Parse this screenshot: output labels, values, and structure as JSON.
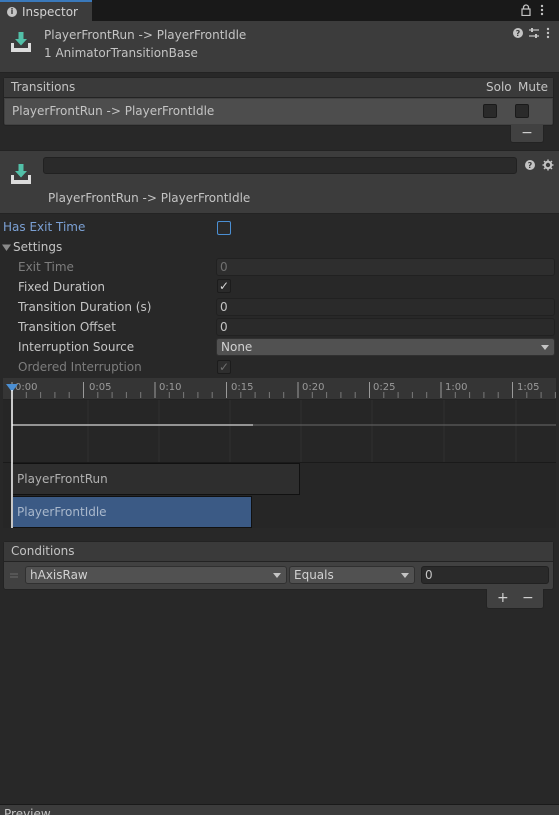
{
  "tab": {
    "label": "Inspector",
    "icon": "info-icon"
  },
  "header": {
    "title": "PlayerFrontRun -> PlayerFrontIdle",
    "subtitle": "1 AnimatorTransitionBase"
  },
  "transitions": {
    "heading": "Transitions",
    "solo_label": "Solo",
    "mute_label": "Mute",
    "row_label": "PlayerFrontRun -> PlayerFrontIdle",
    "remove_label": "−"
  },
  "transition": {
    "name_value": "",
    "title": "PlayerFrontRun -> PlayerFrontIdle"
  },
  "settings": {
    "has_exit_time_label": "Has Exit Time",
    "settings_label": "Settings",
    "exit_time_label": "Exit Time",
    "exit_time_value": "0",
    "fixed_duration_label": "Fixed Duration",
    "transition_duration_label": "Transition Duration (s)",
    "transition_duration_value": "0",
    "transition_offset_label": "Transition Offset",
    "transition_offset_value": "0",
    "interruption_source_label": "Interruption Source",
    "interruption_source_value": "None",
    "ordered_interruption_label": "Ordered Interruption"
  },
  "timeline": {
    "ticks": [
      "0:00",
      "0:05",
      "0:10",
      "0:15",
      "0:20",
      "0:25",
      "1:00",
      "1:05"
    ],
    "source_clip": "PlayerFrontRun",
    "dest_clip": "PlayerFrontIdle"
  },
  "conditions": {
    "heading": "Conditions",
    "parameter": "hAxisRaw",
    "mode": "Equals",
    "value": "0",
    "add_label": "+",
    "remove_label": "−"
  },
  "preview": {
    "label": "Preview"
  },
  "colors": {
    "accent": "#3a79bb",
    "link_label": "#7ba0d4",
    "dest_clip": "#3b5a85"
  }
}
